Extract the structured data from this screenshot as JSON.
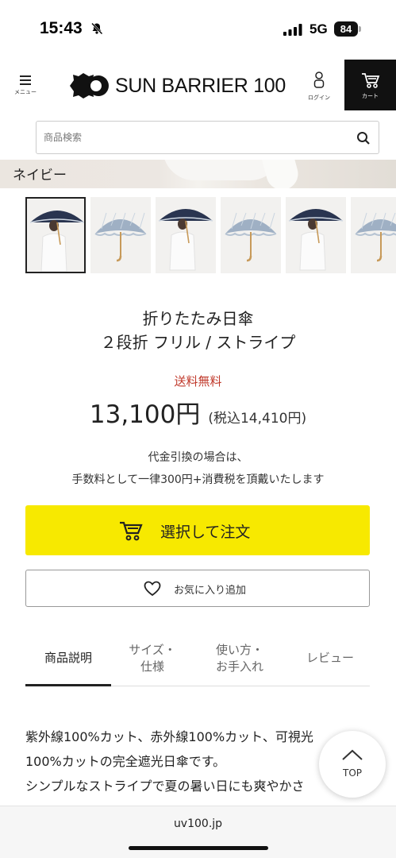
{
  "status_bar": {
    "time": "15:43",
    "network": "5G",
    "battery": "84"
  },
  "header": {
    "menu_label": "メニュー",
    "logo_text": "SUN BARRIER 100",
    "login_label": "ログイン",
    "cart_label": "カート"
  },
  "search": {
    "placeholder": "商品検索"
  },
  "product": {
    "color_label": "ネイビー",
    "thumbnails": [
      {
        "variant": "navy",
        "selected": true
      },
      {
        "variant": "blue",
        "selected": false
      },
      {
        "variant": "navy",
        "selected": false
      },
      {
        "variant": "blue",
        "selected": false
      },
      {
        "variant": "navy",
        "selected": false
      },
      {
        "variant": "blue",
        "selected": false
      }
    ],
    "title_line1": "折りたたみ日傘",
    "title_line2": "２段折 フリル / ストライプ",
    "free_shipping": "送料無料",
    "price": "13,100円",
    "price_tax": "(税込14,410円)",
    "cod_line1": "代金引換の場合は、",
    "cod_line2": "手数料として一律300円+消費税を頂戴いたします",
    "order_button": "選択して注文",
    "favorite_button": "お気に入り追加"
  },
  "tabs": [
    {
      "line1": "商品説明",
      "line2": "",
      "active": true
    },
    {
      "line1": "サイズ・",
      "line2": "仕様",
      "active": false
    },
    {
      "line1": "使い方・",
      "line2": "お手入れ",
      "active": false
    },
    {
      "line1": "レビュー",
      "line2": "",
      "active": false
    }
  ],
  "description": {
    "line1": "紫外線100%カット、赤外線100%カット、可視光",
    "line2": "100%カットの完全遮光日傘です。",
    "line3": "シンプルなストライプで夏の暑い日にも爽やかさ"
  },
  "top_button": "TOP",
  "browser": {
    "url": "uv100.jp"
  },
  "colors": {
    "accent_yellow": "#f7e900",
    "free_shipping_red": "#c0392b",
    "cart_bg": "#111111"
  }
}
